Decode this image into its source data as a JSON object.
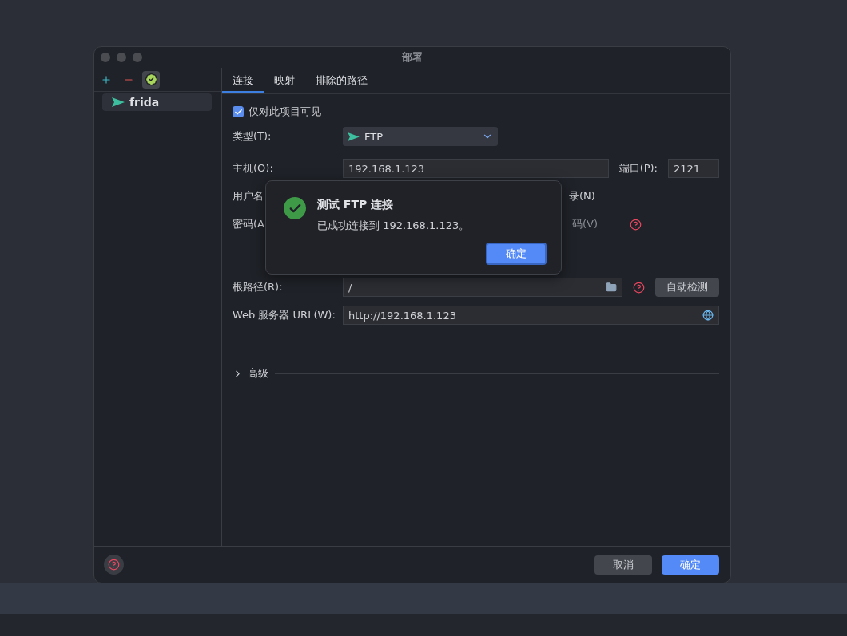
{
  "window": {
    "title": "部署"
  },
  "sidebar": {
    "check_active": true,
    "items": [
      {
        "label": "frida",
        "selected": true
      }
    ]
  },
  "tabs": [
    {
      "label": "连接",
      "selected": true
    },
    {
      "label": "映射",
      "selected": false
    },
    {
      "label": "排除的路径",
      "selected": false
    }
  ],
  "form": {
    "visible_only": {
      "label": "仅对此项目可见",
      "checked": true
    },
    "type": {
      "label": "类型(T):",
      "value": "FTP"
    },
    "host": {
      "label": "主机(O):",
      "value": "192.168.1.123"
    },
    "port": {
      "label": "端口(P):",
      "value": "2121"
    },
    "username": {
      "label": "用户名",
      "right_label": "录(N)"
    },
    "password": {
      "label": "密码(A",
      "right_label": "码(V)"
    },
    "root_path": {
      "label": "根路径(R):",
      "value": "/",
      "button": "自动检测"
    },
    "web_url": {
      "label": "Web 服务器 URL(W):",
      "value": "http://192.168.1.123"
    },
    "advanced": {
      "label": "高级",
      "expanded": false
    }
  },
  "popup": {
    "title": "测试 FTP 连接",
    "message": "已成功连接到 192.168.1.123。",
    "ok_button": "确定"
  },
  "footer": {
    "cancel_button": "取消",
    "ok_button": "确定"
  }
}
